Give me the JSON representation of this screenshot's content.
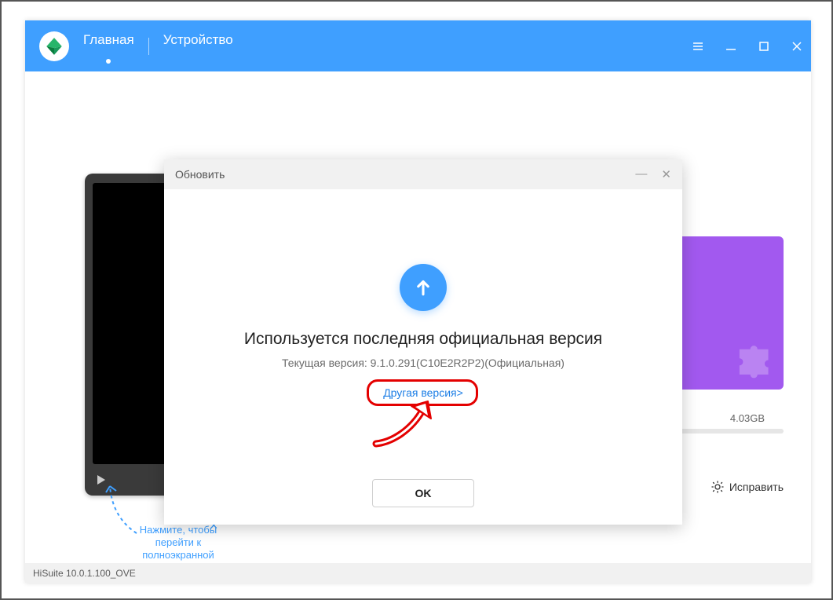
{
  "header": {
    "tab_main": "Главная",
    "tab_device": "Устройство"
  },
  "statusbar": {
    "text": "HiSuite 10.0.1.100_OVE"
  },
  "tip": {
    "text": "Нажмите, чтобы перейти к полноэкранной",
    "close": "×"
  },
  "side": {
    "storage": "4.03GB",
    "fix": "Исправить"
  },
  "modal": {
    "title_bar": "Обновить",
    "heading": "Используется последняя официальная версия",
    "subtext": "Текущая версия: 9.1.0.291(C10E2R2P2)(Официальная)",
    "other_version": "Другая версия>",
    "ok": "OK"
  }
}
